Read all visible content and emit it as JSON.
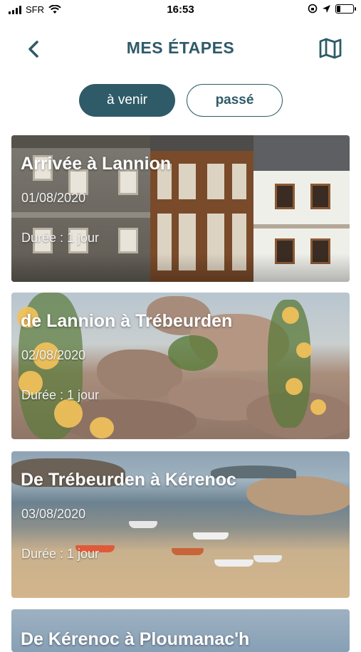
{
  "status_bar": {
    "carrier": "SFR",
    "time": "16:53"
  },
  "header": {
    "title": "MES ÉTAPES",
    "back_icon": "chevron-left-icon",
    "map_icon": "map-icon"
  },
  "segments": {
    "upcoming": "à venir",
    "past": "passé",
    "selected": "à venir"
  },
  "colors": {
    "primary": "#2e5b67",
    "background": "#ffffff"
  },
  "stages": [
    {
      "title": "Arrivée à Lannion",
      "date": "01/08/2020",
      "duration": "Durée : 1 jour"
    },
    {
      "title": "de Lannion à Trébeurden",
      "date": "02/08/2020",
      "duration": "Durée : 1 jour"
    },
    {
      "title": "De Trébeurden à Kérenoc",
      "date": "03/08/2020",
      "duration": "Durée : 1 jour"
    },
    {
      "title": "De Kérenoc à Ploumanac'h"
    }
  ]
}
